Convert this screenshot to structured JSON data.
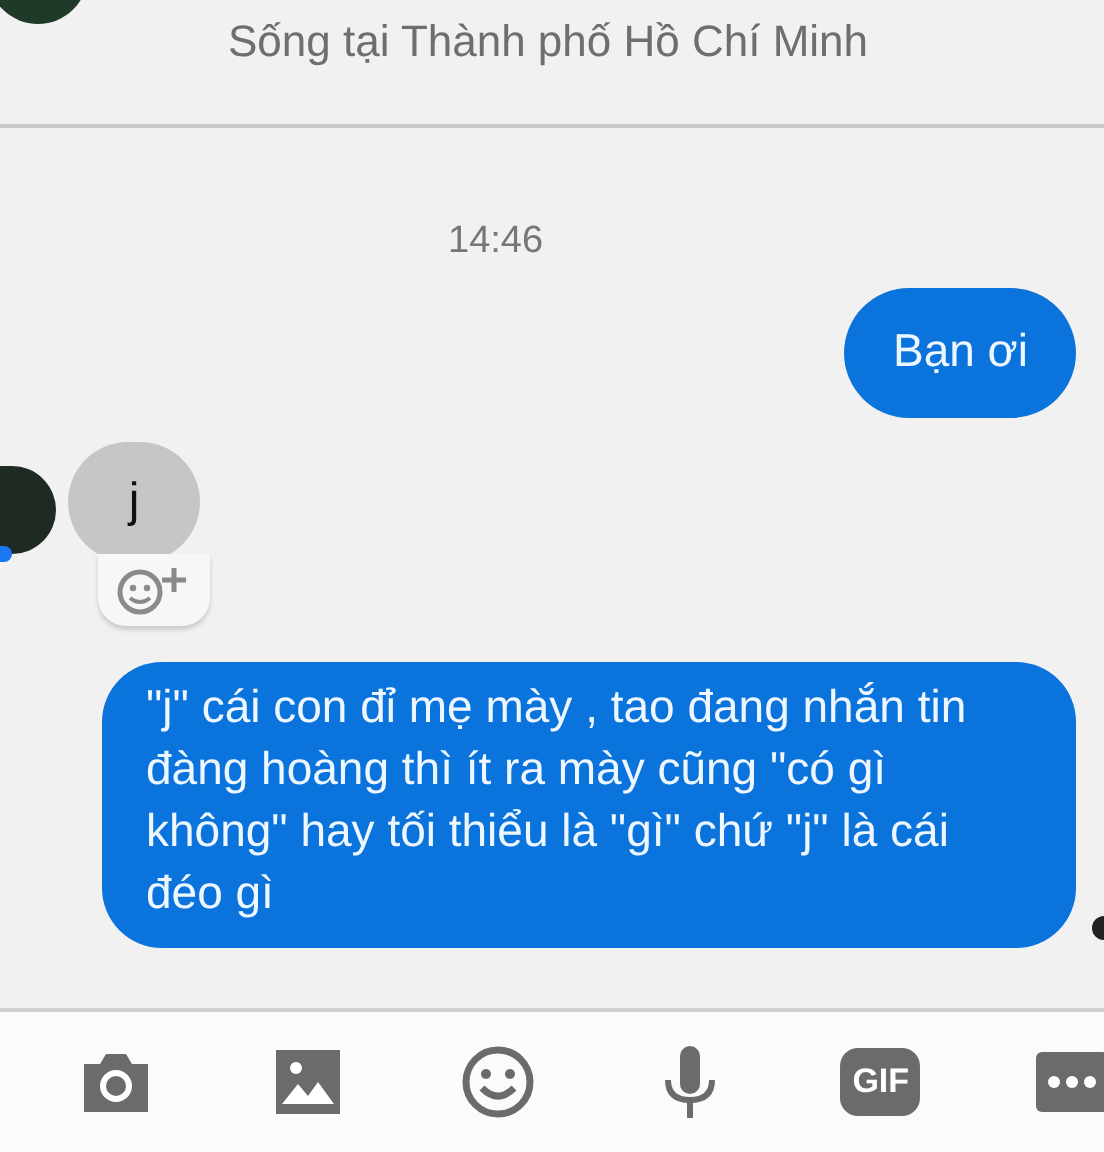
{
  "header": {
    "subtitle": "Sống tại Thành phố Hồ Chí Minh"
  },
  "timestamp": "14:46",
  "messages": [
    {
      "kind": "outgoing",
      "text": "Bạn ơi",
      "seen": false
    },
    {
      "kind": "incoming",
      "text": "j",
      "reaction_button": true
    },
    {
      "kind": "outgoing",
      "text": "\"j\" cái con đỉ mẹ mày , tao đang nhắn tin đàng hoàng thì ít ra mày cũng \"có gì không\" hay tối thiểu là \"gì\" chứ \"j\" là cái đéo gì",
      "seen": true
    }
  ],
  "toolbar": [
    {
      "kind": "camera"
    },
    {
      "kind": "image"
    },
    {
      "kind": "emoji"
    },
    {
      "kind": "mic"
    },
    {
      "kind": "gif",
      "label": "GIF"
    },
    {
      "kind": "more"
    }
  ]
}
